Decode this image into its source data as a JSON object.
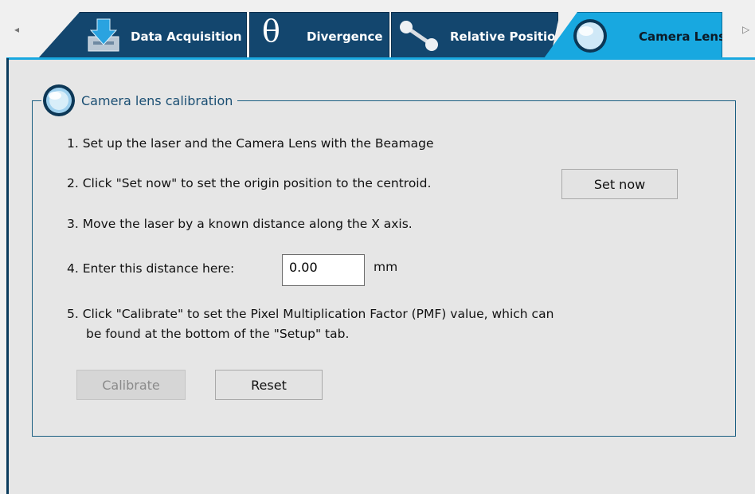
{
  "tabs": [
    {
      "label": "Data Acquisition",
      "icon": "download-icon"
    },
    {
      "label": "Divergence",
      "icon": "theta-icon"
    },
    {
      "label": "Relative Position",
      "icon": "position-icon"
    },
    {
      "label": "Camera Lens",
      "icon": "lens-icon",
      "active": true
    }
  ],
  "tab_scroll": {
    "left": "◂",
    "right": "▷"
  },
  "group": {
    "title": "Camera lens calibration",
    "icon": "lens-icon"
  },
  "steps": {
    "s1": "1. Set up the laser and the Camera Lens with the Beamage",
    "s2": "2. Click \"Set now\" to set the origin position to the centroid.",
    "s3": "3. Move the laser by a known distance along the X axis.",
    "s4": "4. Enter this distance here:",
    "s5_line1": "5. Click \"Calibrate\" to set the Pixel Multiplication Factor (PMF) value, which can",
    "s5_line2": "be found at the bottom of the \"Setup\" tab."
  },
  "distance": {
    "value": "0.00",
    "unit": "mm"
  },
  "buttons": {
    "set_now": "Set now",
    "calibrate": "Calibrate",
    "reset": "Reset"
  },
  "colors": {
    "tab_inactive": "#13466e",
    "tab_active": "#18a8e0",
    "group_border": "#1b5f82",
    "panel_bg": "#e6e6e6"
  }
}
